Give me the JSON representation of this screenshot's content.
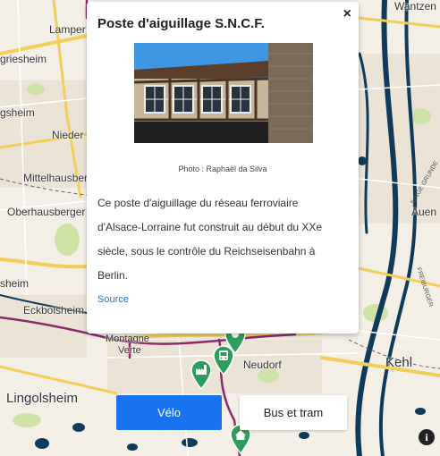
{
  "map": {
    "places": [
      {
        "id": "wantzen",
        "label": "Wantzen",
        "size": "sm"
      },
      {
        "id": "lampertheim",
        "label": "Lamper",
        "size": "sm"
      },
      {
        "id": "griesheim",
        "label": "griesheim",
        "size": "sm"
      },
      {
        "id": "gsheim",
        "label": "gsheim",
        "size": "sm"
      },
      {
        "id": "nieder",
        "label": "Nieder",
        "size": "sm"
      },
      {
        "id": "mittelhausbergen",
        "label": "Mittelhausber",
        "size": "sm"
      },
      {
        "id": "oberhausbergen",
        "label": "Oberhausberger",
        "size": "sm"
      },
      {
        "id": "sheim",
        "label": "sheim",
        "size": "sm"
      },
      {
        "id": "eckbolsheim",
        "label": "Eckbolsheim",
        "size": "sm"
      },
      {
        "id": "montagne-verte-1",
        "label": "Montagne",
        "size": "sm"
      },
      {
        "id": "montagne-verte-2",
        "label": "Verte",
        "size": "sm"
      },
      {
        "id": "neudorf",
        "label": "Neudorf",
        "size": "sm"
      },
      {
        "id": "kehl",
        "label": "Kehl",
        "size": "lg"
      },
      {
        "id": "lingolsheim",
        "label": "Lingolsheim",
        "size": "lg"
      },
      {
        "id": "auen",
        "label": "Auen",
        "size": "sm"
      }
    ],
    "road_labels": [
      "FREIBURGER",
      "JUNGE GRUNDE"
    ],
    "colors": {
      "land": "#f3efe6",
      "water": "#0f3a5a",
      "park": "#cfe3a6",
      "road_major": "#f2cf5b",
      "tram": "#8b2a6b",
      "marker": "#2e9d5c"
    }
  },
  "popup": {
    "title": "Poste d'aiguillage S.N.C.F.",
    "close_icon": "×",
    "photo_credit": "Photo : Raphaël da Silva",
    "description": "Ce poste d'aiguillage du réseau ferroviaire d'Alsace-Lorraine fut construit au début du XXe siècle, sous le contrôle du Reichseisenbahn à Berlin.",
    "source_link": "Source"
  },
  "buttons": {
    "velo": "Vélo",
    "bus_tram": "Bus et tram"
  },
  "info_icon": "i"
}
